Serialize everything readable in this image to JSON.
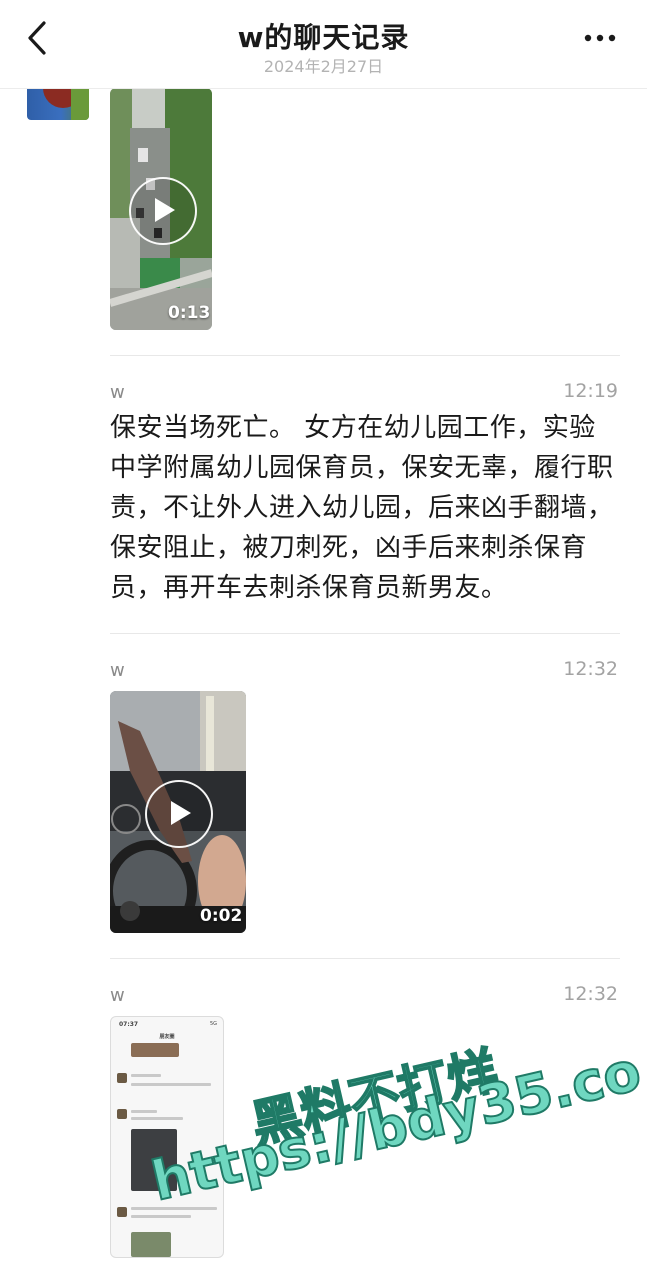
{
  "header": {
    "title": "w的聊天记录",
    "date": "2024年2月27日"
  },
  "messages": [
    {
      "type": "video",
      "duration": "0:13"
    },
    {
      "type": "text",
      "sender": "w",
      "time": "12:19",
      "text": "保安当场死亡。 女方在幼儿园工作，实验中学附属幼儿园保育员，保安无辜，履行职责，不让外人进入幼儿园，后来凶手翻墙，保安阻止，被刀刺死，凶手后来刺杀保育员，再开车去刺杀保育员新男友。"
    },
    {
      "type": "video",
      "sender": "w",
      "time": "12:32",
      "duration": "0:02"
    },
    {
      "type": "image",
      "sender": "w",
      "time": "12:32",
      "thumbnail": {
        "status_time": "07:37",
        "status_icons": "5G",
        "title": "朋友圈"
      }
    }
  ],
  "watermark": {
    "line1": "黑料不打烊",
    "line2": "https://bdy35.co"
  },
  "icons": {
    "back": "chevron-left-icon",
    "more": "more-dots-icon",
    "play": "play-icon"
  },
  "colors": {
    "watermark_fill": "#6fd7c0",
    "watermark_stroke": "#1f7a66"
  }
}
